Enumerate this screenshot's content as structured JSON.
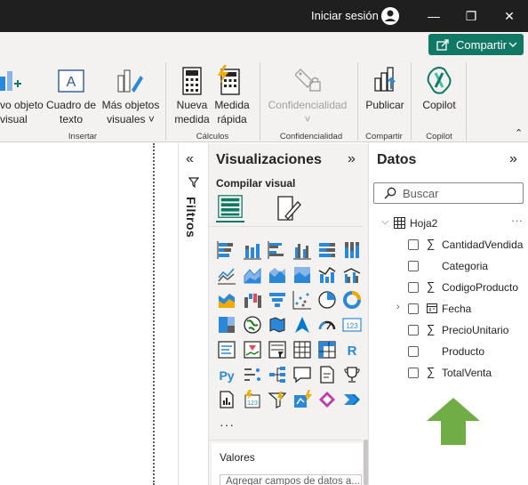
{
  "titlebar": {
    "signin_label": "Iniciar sesión",
    "minimize": "—",
    "restore": "❐",
    "close": "✕"
  },
  "share": {
    "label": "Compartir",
    "accent": "#117865"
  },
  "ribbon": {
    "items": [
      {
        "key": "nuevo_objeto",
        "line1": "vo objeto",
        "line2": "visual"
      },
      {
        "key": "cuadro_texto",
        "line1": "Cuadro de",
        "line2": "texto"
      },
      {
        "key": "mas_objetos",
        "line1": "Más objetos",
        "line2": "visuales ˅"
      },
      {
        "key": "nueva_medida",
        "line1": "Nueva",
        "line2": "medida"
      },
      {
        "key": "medida_rapida",
        "line1": "Medida",
        "line2": "rápida"
      },
      {
        "key": "confidencialidad",
        "line1": "Confidencialidad",
        "line2": "˅"
      },
      {
        "key": "publicar",
        "line1": "Publicar",
        "line2": ""
      },
      {
        "key": "copilot",
        "line1": "Copilot",
        "line2": ""
      }
    ],
    "groups": {
      "insertar": "Insertar",
      "calculos": "Cálculos",
      "confidencialidad": "Confidencialidad",
      "compartir": "Compartir",
      "copilot": "Copilot"
    }
  },
  "filters": {
    "label": "Filtros",
    "collapse": "«"
  },
  "visualizations": {
    "title": "Visualizaciones",
    "expand": "»",
    "build_label": "Compilar visual",
    "more": "···",
    "values_label": "Valores",
    "values_placeholder": "Agregar campos de datos a..."
  },
  "data": {
    "title": "Datos",
    "expand": "»",
    "search_placeholder": "Buscar",
    "table": {
      "name": "Hoja2",
      "more": "···"
    },
    "fields": [
      {
        "name": "CantidadVendida",
        "icon": "sigma-icon"
      },
      {
        "name": "Categoria",
        "icon": ""
      },
      {
        "name": "CodigoProducto",
        "icon": "sigma-icon"
      },
      {
        "name": "Fecha",
        "icon": "calendar-icon",
        "expandable": true
      },
      {
        "name": "PrecioUnitario",
        "icon": "sigma-icon"
      },
      {
        "name": "Producto",
        "icon": ""
      },
      {
        "name": "TotalVenta",
        "icon": "sigma-icon"
      }
    ]
  },
  "colors": {
    "accent": "#117865",
    "arrow": "#70ad47"
  }
}
